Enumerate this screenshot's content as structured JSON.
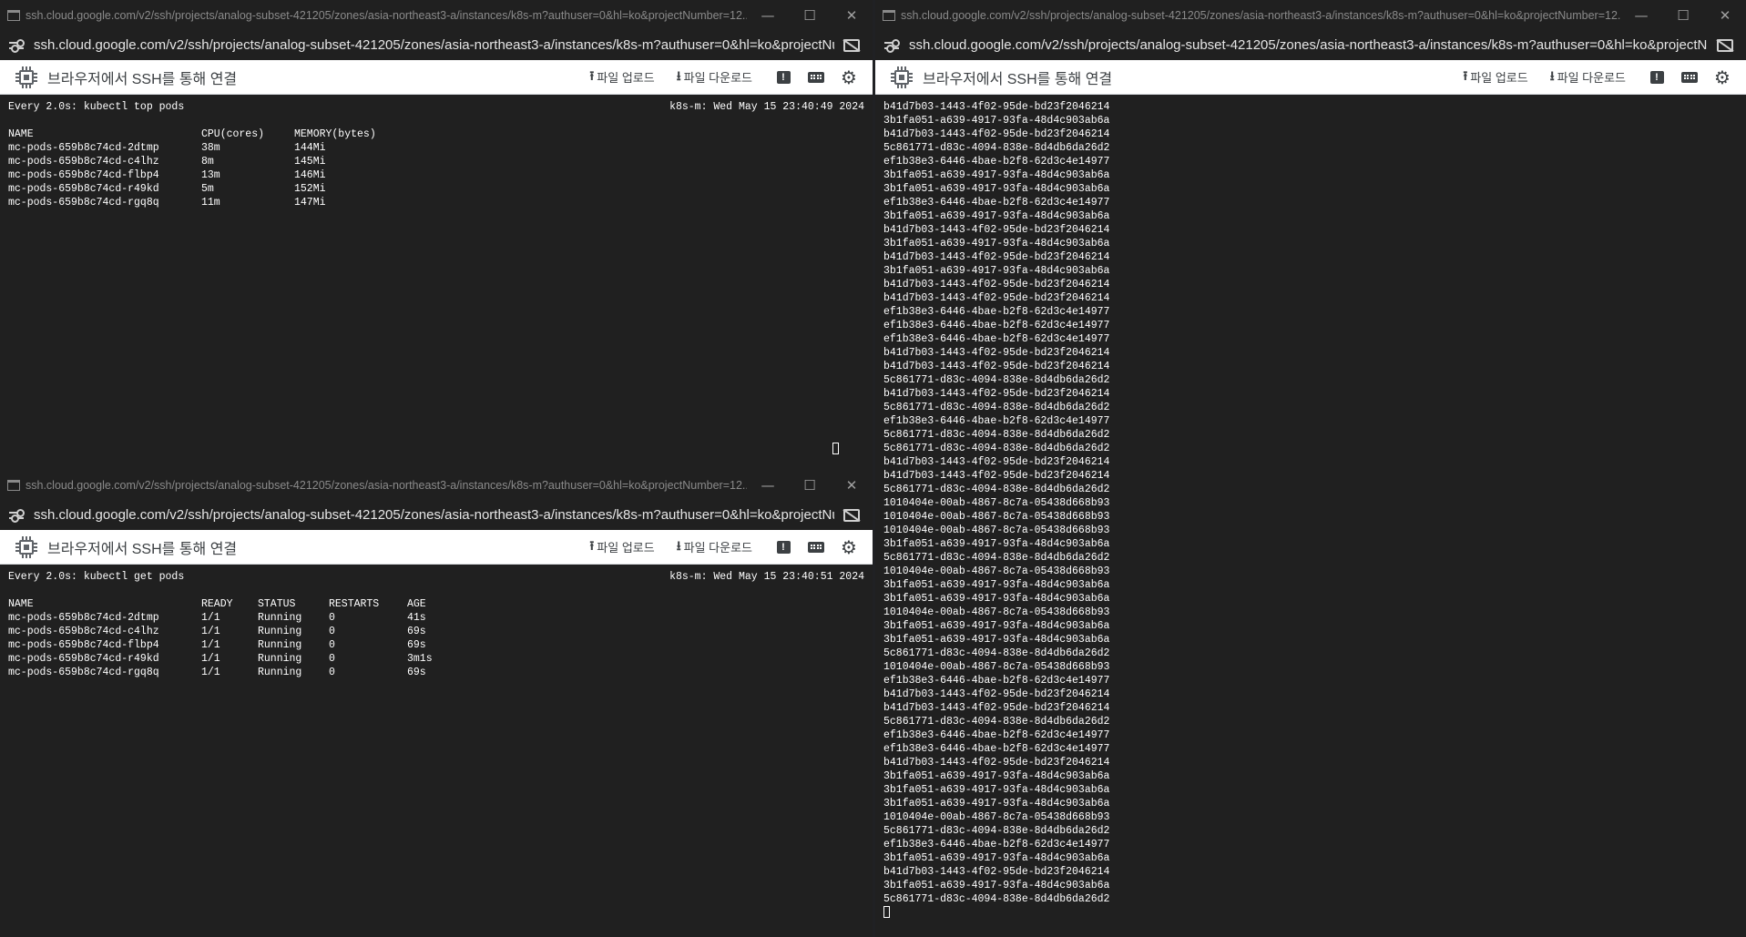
{
  "windows": {
    "top_left": {
      "title": "ssh.cloud.google.com/v2/ssh/projects/analog-subset-421205/zones/asia-northeast3-a/instances/k8s-m?authuser=0&hl=ko&projectNumber=12...",
      "url": "ssh.cloud.google.com/v2/ssh/projects/analog-subset-421205/zones/asia-northeast3-a/instances/k8s-m?authuser=0&hl=ko&projectNu...",
      "app_title": "브라우저에서 SSH를 통해 연결",
      "upload_label": "파일 업로드",
      "download_label": "파일 다운로드",
      "terminal": {
        "command": "Every 2.0s: kubectl top pods",
        "host_time": "k8s-m: Wed May 15 23:40:49 2024",
        "headers": [
          "NAME",
          "CPU(cores)",
          "MEMORY(bytes)"
        ],
        "rows": [
          [
            "mc-pods-659b8c74cd-2dtmp",
            "38m",
            "144Mi"
          ],
          [
            "mc-pods-659b8c74cd-c4lhz",
            "8m",
            "145Mi"
          ],
          [
            "mc-pods-659b8c74cd-flbp4",
            "13m",
            "146Mi"
          ],
          [
            "mc-pods-659b8c74cd-r49kd",
            "5m",
            "152Mi"
          ],
          [
            "mc-pods-659b8c74cd-rgq8q",
            "11m",
            "147Mi"
          ]
        ]
      }
    },
    "bottom_left": {
      "title": "ssh.cloud.google.com/v2/ssh/projects/analog-subset-421205/zones/asia-northeast3-a/instances/k8s-m?authuser=0&hl=ko&projectNumber=12...",
      "url": "ssh.cloud.google.com/v2/ssh/projects/analog-subset-421205/zones/asia-northeast3-a/instances/k8s-m?authuser=0&hl=ko&projectNu...",
      "app_title": "브라우저에서 SSH를 통해 연결",
      "upload_label": "파일 업로드",
      "download_label": "파일 다운로드",
      "terminal": {
        "command": "Every 2.0s: kubectl get pods",
        "host_time": "k8s-m: Wed May 15 23:40:51 2024",
        "headers": [
          "NAME",
          "READY",
          "STATUS",
          "RESTARTS",
          "AGE"
        ],
        "rows": [
          [
            "mc-pods-659b8c74cd-2dtmp",
            "1/1",
            "Running",
            "0",
            "41s"
          ],
          [
            "mc-pods-659b8c74cd-c4lhz",
            "1/1",
            "Running",
            "0",
            "69s"
          ],
          [
            "mc-pods-659b8c74cd-flbp4",
            "1/1",
            "Running",
            "0",
            "69s"
          ],
          [
            "mc-pods-659b8c74cd-r49kd",
            "1/1",
            "Running",
            "0",
            "3m1s"
          ],
          [
            "mc-pods-659b8c74cd-rgq8q",
            "1/1",
            "Running",
            "0",
            "69s"
          ]
        ]
      }
    },
    "right": {
      "title": "ssh.cloud.google.com/v2/ssh/projects/analog-subset-421205/zones/asia-northeast3-a/instances/k8s-m?authuser=0&hl=ko&projectNumber=12...",
      "url": "ssh.cloud.google.com/v2/ssh/projects/analog-subset-421205/zones/asia-northeast3-a/instances/k8s-m?authuser=0&hl=ko&projectNu...",
      "app_title": "브라우저에서 SSH를 통해 연결",
      "upload_label": "파일 업로드",
      "download_label": "파일 다운로드",
      "terminal": {
        "lines": [
          "b41d7b03-1443-4f02-95de-bd23f2046214",
          "3b1fa051-a639-4917-93fa-48d4c903ab6a",
          "b41d7b03-1443-4f02-95de-bd23f2046214",
          "5c861771-d83c-4094-838e-8d4db6da26d2",
          "ef1b38e3-6446-4bae-b2f8-62d3c4e14977",
          "3b1fa051-a639-4917-93fa-48d4c903ab6a",
          "3b1fa051-a639-4917-93fa-48d4c903ab6a",
          "ef1b38e3-6446-4bae-b2f8-62d3c4e14977",
          "3b1fa051-a639-4917-93fa-48d4c903ab6a",
          "b41d7b03-1443-4f02-95de-bd23f2046214",
          "3b1fa051-a639-4917-93fa-48d4c903ab6a",
          "b41d7b03-1443-4f02-95de-bd23f2046214",
          "3b1fa051-a639-4917-93fa-48d4c903ab6a",
          "b41d7b03-1443-4f02-95de-bd23f2046214",
          "b41d7b03-1443-4f02-95de-bd23f2046214",
          "ef1b38e3-6446-4bae-b2f8-62d3c4e14977",
          "ef1b38e3-6446-4bae-b2f8-62d3c4e14977",
          "ef1b38e3-6446-4bae-b2f8-62d3c4e14977",
          "b41d7b03-1443-4f02-95de-bd23f2046214",
          "b41d7b03-1443-4f02-95de-bd23f2046214",
          "5c861771-d83c-4094-838e-8d4db6da26d2",
          "b41d7b03-1443-4f02-95de-bd23f2046214",
          "5c861771-d83c-4094-838e-8d4db6da26d2",
          "ef1b38e3-6446-4bae-b2f8-62d3c4e14977",
          "5c861771-d83c-4094-838e-8d4db6da26d2",
          "5c861771-d83c-4094-838e-8d4db6da26d2",
          "b41d7b03-1443-4f02-95de-bd23f2046214",
          "b41d7b03-1443-4f02-95de-bd23f2046214",
          "5c861771-d83c-4094-838e-8d4db6da26d2",
          "1010404e-00ab-4867-8c7a-05438d668b93",
          "1010404e-00ab-4867-8c7a-05438d668b93",
          "1010404e-00ab-4867-8c7a-05438d668b93",
          "3b1fa051-a639-4917-93fa-48d4c903ab6a",
          "5c861771-d83c-4094-838e-8d4db6da26d2",
          "1010404e-00ab-4867-8c7a-05438d668b93",
          "3b1fa051-a639-4917-93fa-48d4c903ab6a",
          "3b1fa051-a639-4917-93fa-48d4c903ab6a",
          "1010404e-00ab-4867-8c7a-05438d668b93",
          "3b1fa051-a639-4917-93fa-48d4c903ab6a",
          "3b1fa051-a639-4917-93fa-48d4c903ab6a",
          "5c861771-d83c-4094-838e-8d4db6da26d2",
          "1010404e-00ab-4867-8c7a-05438d668b93",
          "ef1b38e3-6446-4bae-b2f8-62d3c4e14977",
          "b41d7b03-1443-4f02-95de-bd23f2046214",
          "b41d7b03-1443-4f02-95de-bd23f2046214",
          "5c861771-d83c-4094-838e-8d4db6da26d2",
          "ef1b38e3-6446-4bae-b2f8-62d3c4e14977",
          "ef1b38e3-6446-4bae-b2f8-62d3c4e14977",
          "b41d7b03-1443-4f02-95de-bd23f2046214",
          "3b1fa051-a639-4917-93fa-48d4c903ab6a",
          "3b1fa051-a639-4917-93fa-48d4c903ab6a",
          "3b1fa051-a639-4917-93fa-48d4c903ab6a",
          "1010404e-00ab-4867-8c7a-05438d668b93",
          "5c861771-d83c-4094-838e-8d4db6da26d2",
          "ef1b38e3-6446-4bae-b2f8-62d3c4e14977",
          "3b1fa051-a639-4917-93fa-48d4c903ab6a",
          "b41d7b03-1443-4f02-95de-bd23f2046214",
          "3b1fa051-a639-4917-93fa-48d4c903ab6a",
          "5c861771-d83c-4094-838e-8d4db6da26d2"
        ]
      }
    }
  },
  "window_controls": {
    "minimize": "—",
    "maximize": "☐",
    "close": "✕"
  },
  "icons": {
    "window": "terminal-window-icon",
    "site_info": "site-settings-icon",
    "no_image": "images-blocked-icon",
    "app": "chip-icon",
    "upload": "upload-icon",
    "download": "download-icon",
    "feedback": "feedback-icon",
    "keyboard": "keyboard-icon",
    "settings": "gear-icon"
  }
}
